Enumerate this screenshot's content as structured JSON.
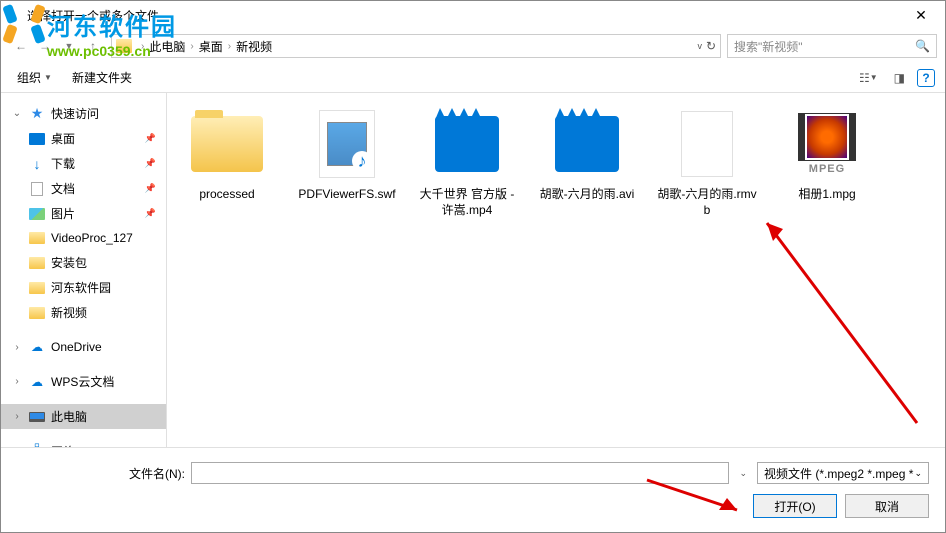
{
  "title": "选择打开一个或多个文件",
  "watermark": {
    "text": "河东软件园",
    "url": "www.pc0359.cn"
  },
  "breadcrumbs": [
    "此电脑",
    "桌面",
    "新视频"
  ],
  "search": {
    "placeholder": "搜索\"新视频\""
  },
  "toolbar": {
    "organize": "组织",
    "new_folder": "新建文件夹"
  },
  "sidebar": {
    "quick_access": "快速访问",
    "items_pinned": [
      {
        "label": "桌面",
        "icon": "blue"
      },
      {
        "label": "下载",
        "icon": "dl"
      },
      {
        "label": "文档",
        "icon": "doc"
      },
      {
        "label": "图片",
        "icon": "pic"
      }
    ],
    "items_recent": [
      {
        "label": "VideoProc_127"
      },
      {
        "label": "安装包"
      },
      {
        "label": "河东软件园"
      },
      {
        "label": "新视频"
      }
    ],
    "onedrive": "OneDrive",
    "wps": "WPS云文档",
    "this_pc": "此电脑",
    "network": "网络"
  },
  "files": [
    {
      "name": "processed",
      "type": "folder"
    },
    {
      "name": "PDFViewerFS.swf",
      "type": "swf"
    },
    {
      "name": "大千世界 官方版 - 许嵩.mp4",
      "type": "video"
    },
    {
      "name": "胡歌-六月的雨.avi",
      "type": "video"
    },
    {
      "name": "胡歌-六月的雨.rmvb",
      "type": "blank"
    },
    {
      "name": "相册1.mpg",
      "type": "mpeg",
      "mpeg_label": "MPEG"
    }
  ],
  "bottom": {
    "filename_label": "文件名(N):",
    "filter": "视频文件 (*.mpeg2 *.mpeg *",
    "open": "打开(O)",
    "cancel": "取消"
  }
}
